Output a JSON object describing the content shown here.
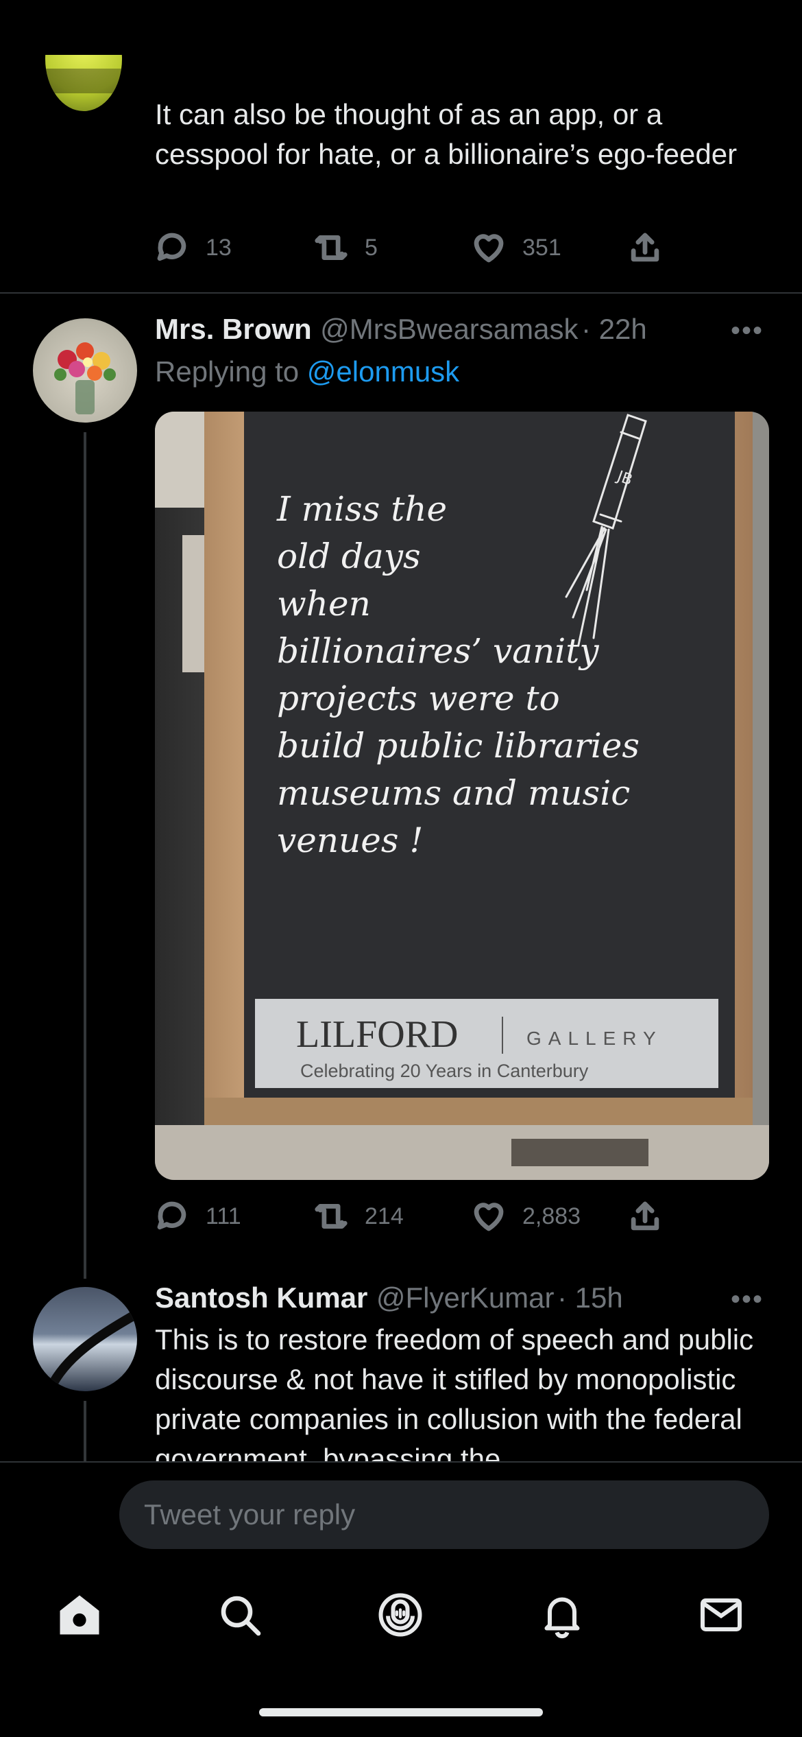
{
  "tweet_top": {
    "text": "It can also be thought of as an app, or a cesspool for hate, or a billionaire’s ego-feeder",
    "actions": {
      "replies": "13",
      "retweets": "5",
      "likes": "351"
    }
  },
  "tweet_main": {
    "name": "Mrs. Brown",
    "handle": "@MrsBwearsamask",
    "time": "· 22h",
    "reply_prefix": "Replying to ",
    "reply_to": "@elonmusk",
    "more": "•••",
    "image": {
      "board_lines": [
        "I miss the",
        "old days",
        "when",
        "billionaires’ vanity",
        "projects  were  to",
        "build public libraries",
        "museums and music",
        "venues !"
      ],
      "rocket_initials": "JB",
      "sign_brand": "LILFORD",
      "sign_gallery": "GALLERY",
      "sign_caption": "Celebrating 20 Years in Canterbury"
    },
    "actions": {
      "replies": "111",
      "retweets": "214",
      "likes": "2,883"
    }
  },
  "tweet_third": {
    "name": "Santosh Kumar",
    "handle": "@FlyerKumar",
    "time": "· 15h",
    "more": "•••",
    "text": "This is to restore freedom of speech and public discourse & not have it stifled by monopolistic private companies in collusion with the federal government, bypassing the"
  },
  "reply_box": {
    "placeholder": "Tweet your reply"
  },
  "colors": {
    "background": "#000000",
    "link": "#1d9bf0",
    "muted": "#71767b",
    "text": "#e7e9ea",
    "divider": "#2f3336"
  },
  "nav": {
    "home": "home-icon",
    "search": "search-icon",
    "spaces": "spaces-icon",
    "notifications": "bell-icon",
    "messages": "mail-icon"
  }
}
